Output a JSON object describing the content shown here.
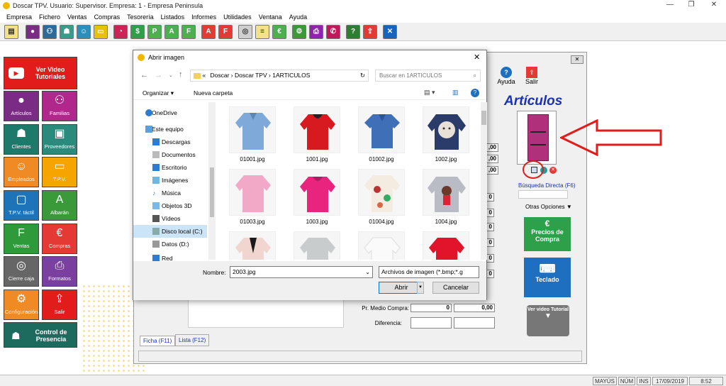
{
  "window": {
    "title": "Doscar TPV. Usuario: Supervisor. Empresa: 1 - Empresa Peninsula"
  },
  "menu": [
    "Empresa",
    "Fichero",
    "Ventas",
    "Compras",
    "Tesorería",
    "Listados",
    "Informes",
    "Utilidades",
    "Ventana",
    "Ayuda"
  ],
  "sidebar": {
    "video_tile": "Ver Video Tutoriales",
    "tiles": [
      "Artículos",
      "Familias",
      "Clientes",
      "Proveedores",
      "Empleados",
      "T.P.V.",
      "T.P.V. táctil",
      "Albarán",
      "Ventas",
      "Compras",
      "Cierre caja",
      "Formatos",
      "Configuración",
      "Salir"
    ],
    "presence": "Control de Presencia"
  },
  "articulos": {
    "heading": "Artículos",
    "ayuda": "Ayuda",
    "salir": "Salir",
    "busqueda": "Búsqueda Directa (F6)",
    "otras": "Otras Opciones",
    "precios": "Precios de Compra",
    "teclado": "Teclado",
    "ver_video": "Ver video Tutorial",
    "pr_medio_label": "Pr. Medio Compra:",
    "pr_medio_v1": "0",
    "pr_medio_v2": "0,00",
    "diferencia_label": "Diferencia:",
    "zero_a": ",00",
    "zero_b": ",00",
    "zero_c": ",00",
    "zero_single": "0",
    "tab1": "Ficha (F11)",
    "tab2": "Lista (F12)"
  },
  "dialog": {
    "title": "Abrir imagen",
    "breadcrumb": [
      "«",
      "Doscar",
      "Doscar TPV",
      "1ARTICULOS"
    ],
    "search_placeholder": "Buscar en 1ARTICULOS",
    "organizar": "Organizar",
    "nueva": "Nueva carpeta",
    "nav": [
      "OneDrive",
      "Este equipo",
      "Descargas",
      "Documentos",
      "Escritorio",
      "Imágenes",
      "Música",
      "Objetos 3D",
      "Vídeos",
      "Disco local (C:)",
      "Datos (D:)",
      "Red"
    ],
    "files": [
      "01001.jpg",
      "1001.jpg",
      "01002.jpg",
      "1002.jpg",
      "01003.jpg",
      "1003.jpg",
      "01004.jpg",
      "1004.jpg"
    ],
    "nombre_label": "Nombre:",
    "nombre_value": "2003.jpg",
    "filter": "Archivos de imagen (*.bmp;*.g",
    "abrir": "Abrir",
    "cancelar": "Cancelar"
  },
  "status": {
    "mayus": "MAYÚS",
    "num": "NÚM",
    "ins": "INS",
    "date": "17/09/2019",
    "time": "8:52"
  }
}
